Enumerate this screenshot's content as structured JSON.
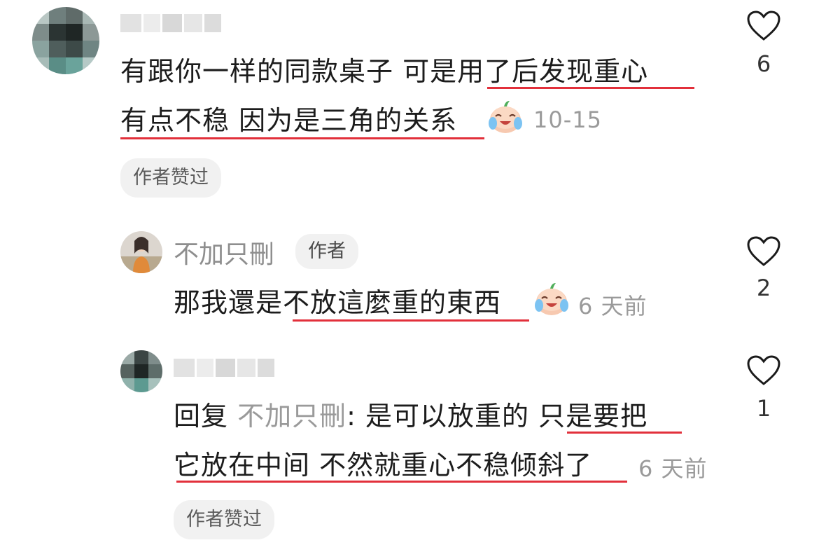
{
  "comments": [
    {
      "text_line1_pre": "有跟你一样的同款桌子 可是",
      "text_line1_ul": "用了后发现重心",
      "text_line2_ul": "有点不稳 因为是三角的关系",
      "time": "10-15",
      "badge": "作者赞过",
      "likes": "6"
    }
  ],
  "replies": [
    {
      "author": "不加只刪",
      "author_badge": "作者",
      "text_pre": "那我還是",
      "text_ul": "不放這麼重的東西",
      "time": "6 天前",
      "likes": "2"
    },
    {
      "reply_prefix": "回复",
      "reply_to": "不加只刪",
      "line1_pre": ": 是可以放重的 ",
      "line1_ul": "只是要把",
      "line2_ul": "它放在中间 不然就重心不稳倾斜了",
      "time": "6 天前",
      "badge": "作者赞过",
      "likes": "1"
    }
  ],
  "icons": {
    "like": "heart-outline-icon",
    "emoji": "crying-laughing-emoji"
  },
  "colors": {
    "underline": "#e2303b",
    "meta": "#9a9a9a",
    "pill_bg": "#f1f1f1"
  }
}
